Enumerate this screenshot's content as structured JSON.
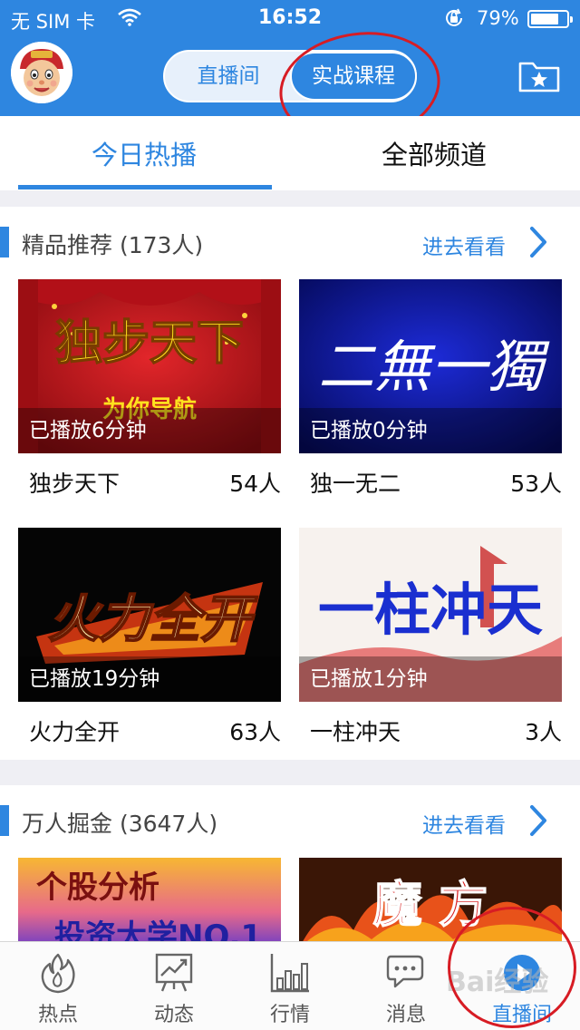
{
  "status_bar": {
    "carrier": "无 SIM 卡",
    "time": "16:52",
    "battery": "79%",
    "battery_level": 0.79,
    "icons": [
      "wifi-icon",
      "orientation-lock-icon",
      "battery-icon"
    ]
  },
  "header": {
    "avatar_icon": "cartoon-avatar",
    "segment": {
      "live": "直播间",
      "course": "实战课程",
      "selected": "course"
    },
    "favorite_icon": "folder-star-icon"
  },
  "subtabs": {
    "today": "今日热播",
    "all": "全部频道",
    "selected": "today"
  },
  "sections": [
    {
      "title": "精品推荐 (173人)",
      "more": "进去看看",
      "items": [
        {
          "name": "独步天下",
          "count": "54人",
          "played": "已播放6分钟",
          "thumb_text": "独步天下",
          "thumb_sub": "为你导航"
        },
        {
          "name": "独一无二",
          "count": "53人",
          "played": "已播放0分钟",
          "thumb_text": "二無一獨",
          "thumb_sub": ""
        },
        {
          "name": "火力全开",
          "count": "63人",
          "played": "已播放19分钟",
          "thumb_text": "火力全开",
          "thumb_sub": ""
        },
        {
          "name": "一柱冲天",
          "count": "3人",
          "played": "已播放1分钟",
          "thumb_text": "一柱冲天",
          "thumb_sub": ""
        }
      ]
    },
    {
      "title": "万人掘金 (3647人)",
      "more": "进去看看",
      "items": [
        {
          "thumb_text": "个股分析",
          "thumb_sub": "投资大学NO.1"
        },
        {
          "thumb_text": "魔 方",
          "thumb_sub": ""
        }
      ]
    }
  ],
  "tabbar": {
    "items": [
      {
        "label": "热点",
        "icon": "flame-icon"
      },
      {
        "label": "动态",
        "icon": "trend-board-icon"
      },
      {
        "label": "行情",
        "icon": "bar-chart-icon"
      },
      {
        "label": "消息",
        "icon": "chat-bubble-icon"
      },
      {
        "label": "直播间",
        "icon": "play-circle-icon"
      }
    ],
    "selected": 4,
    "watermark": "Bai经验"
  },
  "colors": {
    "accent": "#2e86e0",
    "annotation": "#d71c24"
  }
}
